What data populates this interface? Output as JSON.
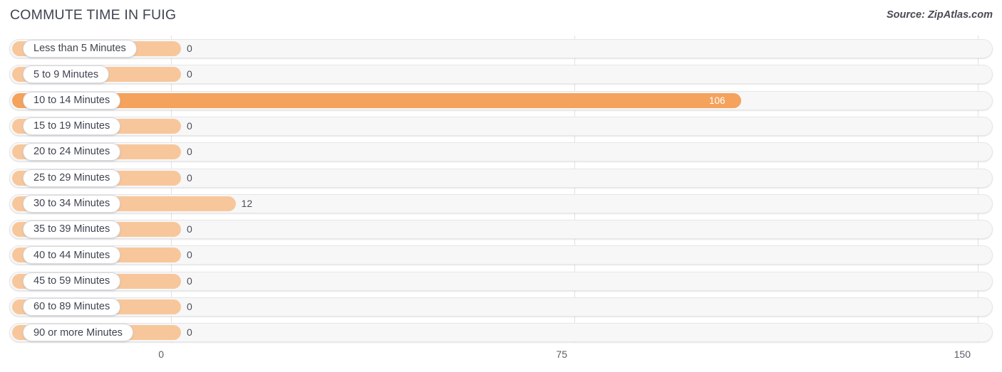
{
  "header": {
    "title": "COMMUTE TIME IN FUIG",
    "source": "Source: ZipAtlas.com"
  },
  "chart_data": {
    "type": "bar",
    "orientation": "horizontal",
    "title": "COMMUTE TIME IN FUIG",
    "subtitle": "Source: ZipAtlas.com",
    "xlabel": "",
    "ylabel": "",
    "xlim": [
      0,
      150
    ],
    "ticks": [
      "0",
      "75",
      "150"
    ],
    "tick_values": [
      0,
      75,
      150
    ],
    "grid": true,
    "legend": false,
    "categories": [
      "Less than 5 Minutes",
      "5 to 9 Minutes",
      "10 to 14 Minutes",
      "15 to 19 Minutes",
      "20 to 24 Minutes",
      "25 to 29 Minutes",
      "30 to 34 Minutes",
      "35 to 39 Minutes",
      "40 to 44 Minutes",
      "45 to 59 Minutes",
      "60 to 89 Minutes",
      "90 or more Minutes"
    ],
    "values": [
      0,
      0,
      106,
      0,
      0,
      0,
      12,
      0,
      0,
      0,
      0,
      0
    ],
    "value_labels": [
      "0",
      "0",
      "106",
      "0",
      "0",
      "0",
      "12",
      "0",
      "0",
      "0",
      "0",
      "0"
    ],
    "colors": {
      "bar_default": "#f7c79b",
      "bar_highlight": "#f5a25c",
      "track": "#f7f7f8",
      "track_border": "#e6e6e8",
      "gridline": "#e2e2e4",
      "text": "#3f4450"
    }
  }
}
